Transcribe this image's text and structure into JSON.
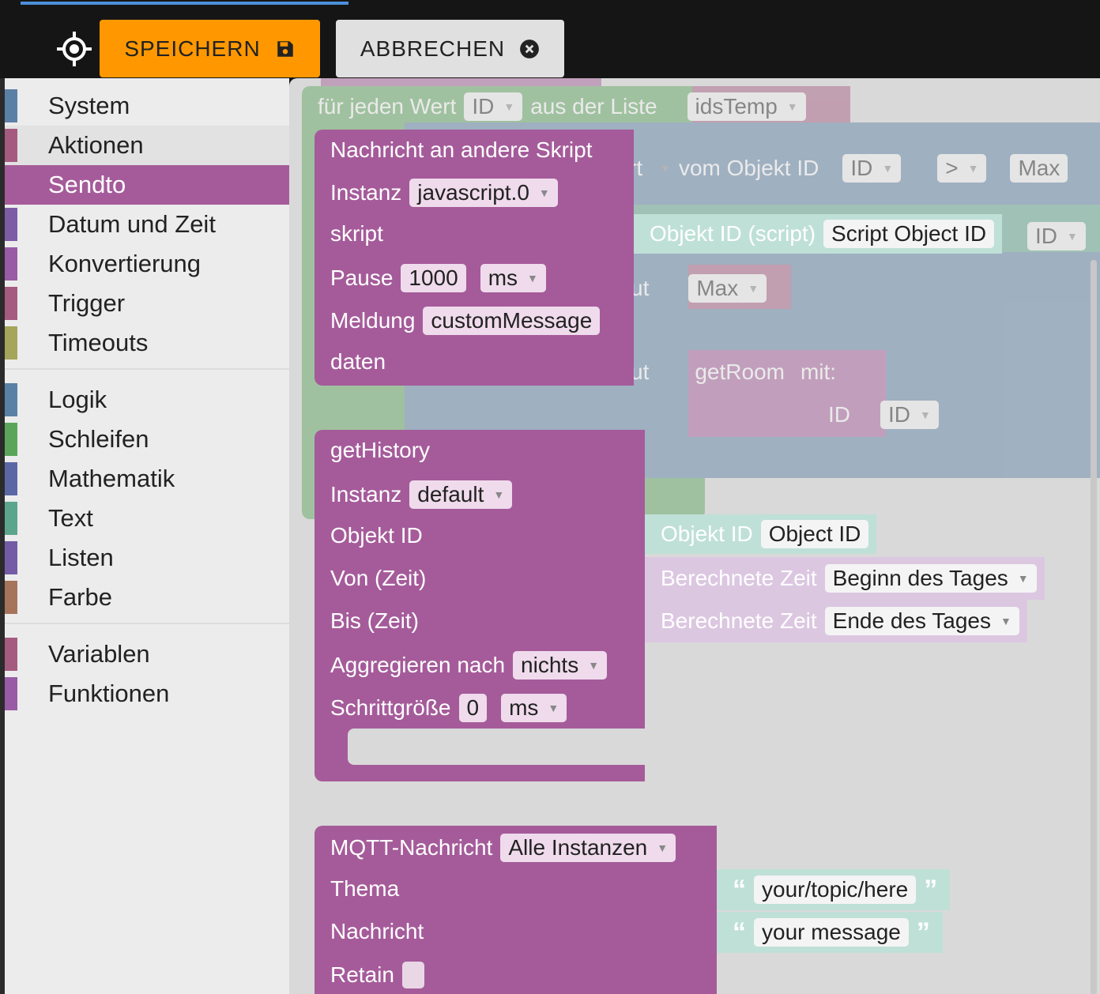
{
  "toolbar": {
    "save_label": "SPEICHERN",
    "cancel_label": "ABBRECHEN",
    "icons": {
      "target": "crosshair-target-icon",
      "save": "floppy-disk-icon",
      "cancel": "close-circle-icon"
    },
    "colors": {
      "save": "#ff9800",
      "cancel": "#e0e0e0",
      "tab_indicator": "#4a90d9"
    }
  },
  "sidebar": {
    "groups": [
      [
        {
          "label": "System",
          "color": "#5b80a5"
        },
        {
          "label": "Aktionen",
          "color": "#a55b80"
        },
        {
          "label": "Sendto",
          "color": "#a55b9a"
        },
        {
          "label": "Datum und Zeit",
          "color": "#7e5ba5"
        },
        {
          "label": "Konvertierung",
          "color": "#995ba5"
        },
        {
          "label": "Trigger",
          "color": "#a55b80"
        },
        {
          "label": "Timeouts",
          "color": "#a5a55b"
        }
      ],
      [
        {
          "label": "Logik",
          "color": "#5b80a5"
        },
        {
          "label": "Schleifen",
          "color": "#5ba55b"
        },
        {
          "label": "Mathematik",
          "color": "#5b67a5"
        },
        {
          "label": "Text",
          "color": "#5ba58c"
        },
        {
          "label": "Listen",
          "color": "#745ba5"
        },
        {
          "label": "Farbe",
          "color": "#a5745b"
        }
      ],
      [
        {
          "label": "Variablen",
          "color": "#a55b80"
        },
        {
          "label": "Funktionen",
          "color": "#995ba5"
        }
      ]
    ],
    "selected": "Sendto",
    "hovered": "Aktionen"
  },
  "background_blocks": {
    "loop_label": "für jeden Wert",
    "loop_var": "ID",
    "from_list": "aus der Liste",
    "list_var": "idsTemp",
    "rt": "rt",
    "from_object": "vom Objekt ID",
    "object_var": "ID",
    "compare_op": ">",
    "max1": "Max",
    "id2": "ID",
    "ut1": "ut",
    "max2": "Max",
    "ut2": "ut",
    "getroom": "getRoom",
    "mit": "mit:",
    "id_label": "ID",
    "id3": "ID"
  },
  "sendto_block": {
    "title": "Nachricht an andere Skript",
    "instanz_label": "Instanz",
    "instanz_value": "javascript.0",
    "skript_label": "skript",
    "pause_label": "Pause",
    "pause_value": "1000",
    "pause_unit": "ms",
    "meldung_label": "Meldung",
    "meldung_value": "customMessage",
    "daten_label": "daten",
    "script_input_label": "Objekt ID (script)",
    "script_input_value": "Script Object ID"
  },
  "history_block": {
    "title": "getHistory",
    "instanz_label": "Instanz",
    "instanz_value": "default",
    "objekt_label": "Objekt ID",
    "von_label": "Von (Zeit)",
    "bis_label": "Bis (Zeit)",
    "aggregieren_label": "Aggregieren nach",
    "aggregieren_value": "nichts",
    "schritt_label": "Schrittgröße",
    "schritt_value": "0",
    "schritt_unit": "ms",
    "objekt_input_label": "Objekt ID",
    "objekt_input_value": "Object ID",
    "von_input_label": "Berechnete Zeit",
    "von_input_value": "Beginn des Tages",
    "bis_input_label": "Berechnete Zeit",
    "bis_input_value": "Ende des Tages"
  },
  "mqtt_block": {
    "title": "MQTT-Nachricht",
    "instanz_value": "Alle Instanzen",
    "thema_label": "Thema",
    "thema_value": "your/topic/here",
    "nachricht_label": "Nachricht",
    "nachricht_value": "your message",
    "retain_label": "Retain"
  },
  "icons": {
    "dropdown": "dropdown-arrow-icon",
    "quote_open": "open-quote-icon",
    "quote_close": "close-quote-icon"
  }
}
